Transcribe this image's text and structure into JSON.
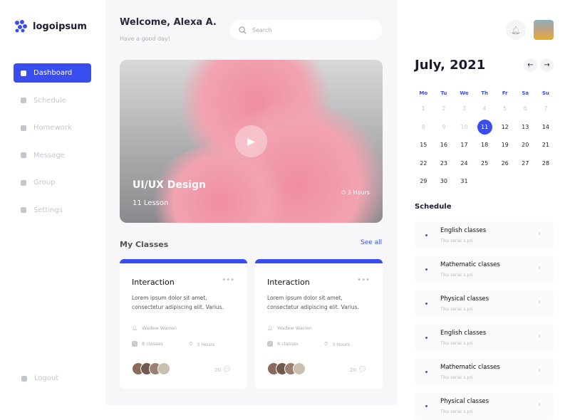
{
  "brand": {
    "name": "logoipsum",
    "accent": "#3a4ef0"
  },
  "sidebar": {
    "items": [
      {
        "label": "Dashboard",
        "icon": "grid-icon",
        "active": true
      },
      {
        "label": "Schedule",
        "icon": "calendar-icon"
      },
      {
        "label": "Homework",
        "icon": "briefcase-icon"
      },
      {
        "label": "Message",
        "icon": "message-icon"
      },
      {
        "label": "Group",
        "icon": "users-icon"
      },
      {
        "label": "Settings",
        "icon": "gear-icon"
      }
    ],
    "logout": "Logout"
  },
  "header": {
    "welcome": "Welcome, Alexa A.",
    "subtitle": "Have a good day!",
    "search_placeholder": "Search"
  },
  "hero": {
    "title": "UI/UX Design",
    "lessons": "11 Lesson",
    "duration": "3 Hours"
  },
  "classes": {
    "title": "My Classes",
    "see_all": "See all",
    "cards": [
      {
        "title": "Interaction",
        "desc": "Lorem ipsum dolor sit amet, consectetur adipiscing elit. Varius.",
        "teacher": "Wadew Warren",
        "classes": "8 classes",
        "hours": "3 Hours",
        "comments": "20"
      },
      {
        "title": "Interaction",
        "desc": "Lorem ipsum dolor sit amet, consectetur adipiscing elit. Varius.",
        "teacher": "Wadew Warren",
        "classes": "8 classes",
        "hours": "3 Hours",
        "comments": "20"
      }
    ]
  },
  "calendar": {
    "month": "July, 2021",
    "weekdays": [
      "Mo",
      "Tu",
      "We",
      "Th",
      "Fr",
      "Sa",
      "Su"
    ],
    "selected": 11,
    "days": [
      1,
      2,
      3,
      4,
      5,
      6,
      7,
      8,
      9,
      10,
      11,
      12,
      13,
      14,
      15,
      16,
      17,
      18,
      19,
      20,
      21,
      22,
      23,
      24,
      25,
      26,
      27,
      28,
      29,
      30,
      31
    ],
    "muted_through": 10
  },
  "schedule": {
    "title": "Schedule",
    "items": [
      {
        "name": "English classes",
        "teacher": "Tika sarak s.pd"
      },
      {
        "name": "Mathematic classes",
        "teacher": "Tika sarak s.pd"
      },
      {
        "name": "Physical classes",
        "teacher": "Tika sarak s.pd"
      },
      {
        "name": "English classes",
        "teacher": "Tika sarak s.pd"
      },
      {
        "name": "Mathematic classes",
        "teacher": "Tika sarak s.pd"
      },
      {
        "name": "Physical classes",
        "teacher": "Tika sarak s.pd"
      }
    ]
  }
}
